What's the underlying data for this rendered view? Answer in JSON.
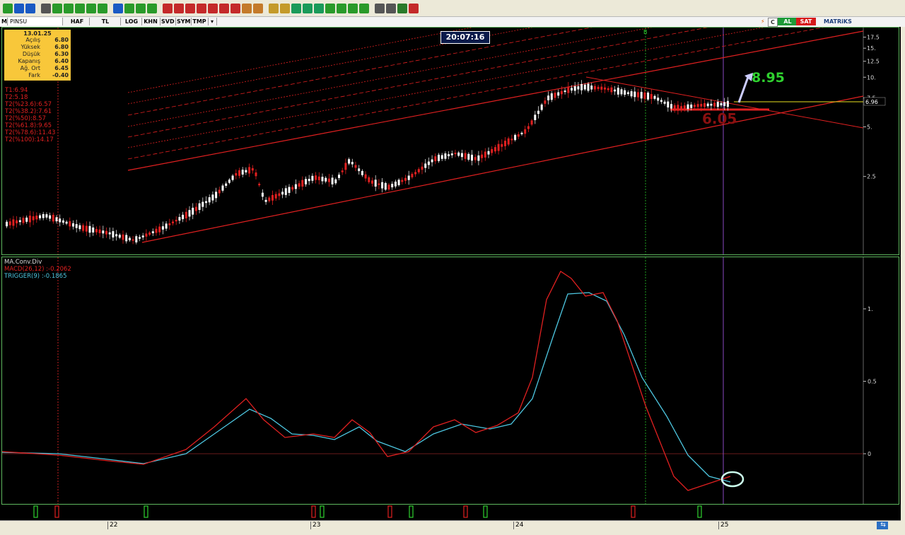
{
  "toolbar": {
    "icons": [
      "lock-icon",
      "cursor-icon",
      "arrow-icon",
      "edit-icon",
      "tool-icon",
      "pen-icon",
      "eraser-icon",
      "line-icon",
      "hline-icon",
      "text-icon",
      "draw-icon",
      "curve-icon",
      "channel-icon",
      "fib-icon",
      "zoom-icon",
      "grid-icon",
      "percent-icon",
      "chart-icon",
      "table-icon",
      "calendar-icon",
      "stripes-icon",
      "doc-icon",
      "alert-icon",
      "bell-icon",
      "nav-icon",
      "zoom-in-icon",
      "zoom-out-icon",
      "back-icon",
      "forward-icon",
      "up-icon",
      "down-icon",
      "print-icon",
      "search-icon",
      "image-icon",
      "m-icon"
    ]
  },
  "infobar": {
    "symbol_prefix": "M",
    "symbol": "PINSU",
    "tabs": [
      "HAF",
      "TL",
      "LOG",
      "KHN",
      "SVD",
      "SYM",
      "TMP"
    ],
    "buy_label": "AL",
    "sell_label": "SAT",
    "brand": "MATRiKS",
    "c_label": "C"
  },
  "ohlc": {
    "date": "13.01.25",
    "rows": [
      {
        "label": "Açılış",
        "value": "6.80"
      },
      {
        "label": "Yüksek",
        "value": "6.80"
      },
      {
        "label": "Düşük",
        "value": "6.30"
      },
      {
        "label": "Kapanış",
        "value": "6.40"
      },
      {
        "label": "Ağ. Ort",
        "value": "6.45"
      },
      {
        "label": "Fark",
        "value": "-0.40"
      }
    ]
  },
  "fib_levels": [
    "T1:6.94",
    "T2:5.18",
    "T2(%23.6):6.57",
    "T2(%38.2):7.61",
    "T2(%50):8.57",
    "T2(%61.8):9.65",
    "T2(%78.6):11.43",
    "T2(%100):14.17"
  ],
  "clock": "20:07:16",
  "marker_b": "B",
  "annotations": {
    "target_up": "8.95",
    "support": "6.05"
  },
  "price_axis": {
    "ticks": [
      "17.5",
      "15.",
      "12.5",
      "10.",
      "7.5",
      "5.",
      "2.5"
    ],
    "last_price": "6.96"
  },
  "macd": {
    "title": "MA.Conv.Div",
    "macd_label": "MACD(26,12)",
    "macd_value": ":-0.2062",
    "trigger_label": "TRIGGER(9)",
    "trigger_value": ":-0.1865",
    "axis_ticks": [
      "1.",
      "0.5",
      "0"
    ]
  },
  "date_axis": [
    "22",
    "23",
    "24",
    "25"
  ],
  "colors": {
    "up_candle": "#ffffff",
    "down_candle": "#e02020",
    "channel": "#e02020",
    "macd": "#e02020",
    "trigger": "#4dc6e0",
    "target": "#2fd12f",
    "support": "#8a1010",
    "ohlc_bg": "#f8c73a"
  }
}
